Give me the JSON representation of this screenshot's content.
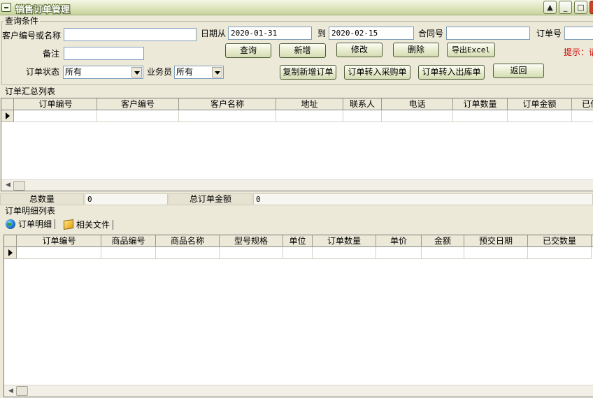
{
  "window": {
    "title": "销售订单管理"
  },
  "query": {
    "group_label": "查询条件",
    "customer_label": "客户编号或名称",
    "customer_value": "",
    "date_from_label": "日期从",
    "date_from_value": "2020-01-31",
    "date_to_label": "到",
    "date_to_value": "2020-02-15",
    "contract_label": "合同号",
    "contract_value": "",
    "order_no_label": "订单号",
    "order_no_value": "",
    "remark_label": "备注",
    "remark_value": "",
    "status_label": "订单状态",
    "status_value": "所有",
    "salesman_label": "业务员",
    "salesman_value": "所有",
    "hint": "提示：请"
  },
  "buttons": {
    "query": "查询",
    "add": "新增",
    "edit": "修改",
    "delete": "删除",
    "export": "导出Excel",
    "copy_add": "复制新增订单",
    "to_purchase": "订单转入采购单",
    "to_outbound": "订单转入出库单",
    "back": "返回"
  },
  "summary": {
    "group_label": "订单汇总列表",
    "columns": [
      "订单编号",
      "客户编号",
      "客户名称",
      "地址",
      "联系人",
      "电话",
      "订单数量",
      "订单金额",
      "已付"
    ],
    "total_qty_label": "总数量",
    "total_qty_value": "0",
    "total_amount_label": "总订单金额",
    "total_amount_value": "0"
  },
  "detail": {
    "group_label": "订单明细列表",
    "tabs": [
      "订单明细",
      "相关文件"
    ],
    "columns": [
      "订单编号",
      "商品编号",
      "商品名称",
      "型号规格",
      "单位",
      "订单数量",
      "单价",
      "金额",
      "预交日期",
      "已交数量"
    ]
  },
  "colors": {
    "window_bg": "#ece9d8",
    "hint": "#d40000",
    "input_border": "#7f9db9"
  }
}
